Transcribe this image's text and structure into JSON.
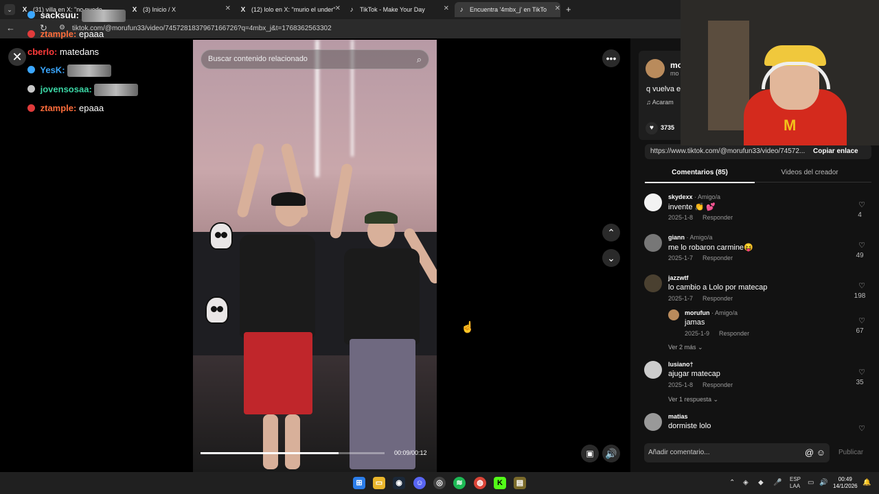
{
  "browser": {
    "tabs": [
      {
        "title": "(31) villa en X: \"no puedo",
        "icon": "x-logo-icon"
      },
      {
        "title": "(3) Inicio / X",
        "icon": "x-logo-icon"
      },
      {
        "title": "(12) lolo en X: \"murio el under\"",
        "icon": "x-logo-icon"
      },
      {
        "title": "TikTok - Make Your Day",
        "icon": "tiktok-logo-icon"
      },
      {
        "title": "Encuentra '4mbx_j' en TikTo",
        "icon": "tiktok-logo-icon"
      }
    ],
    "url": "tiktok.com/@morufun33/video/7457281837967166726?q=4mbx_j&t=1768362563302"
  },
  "chat": [
    {
      "user": "sacksuu",
      "message": "",
      "color": "#ffffff",
      "emote": true
    },
    {
      "user": "ztample",
      "message": "epaaa",
      "color": "#ff6d3b",
      "emote": false
    },
    {
      "user": "cberlo",
      "message": "matedans",
      "color": "#ff3b3b",
      "emote": false
    },
    {
      "user": "YesK",
      "message": "",
      "color": "#3ba7ff",
      "emote": true
    },
    {
      "user": "jovensosaa",
      "message": "",
      "color": "#3bd6a5",
      "emote": true
    },
    {
      "user": "ztample",
      "message": "epaaa",
      "color": "#ff6d3b",
      "emote": false
    }
  ],
  "video": {
    "search_placeholder": "Buscar contenido relacionado",
    "time": "00:09/00:12",
    "progress": 0.75
  },
  "panel": {
    "author_name": "mo",
    "author_sub": "mo",
    "description": "q vuelva e",
    "music": "Acaram",
    "likes": "3735",
    "link": "https://www.tiktok.com/@morufun33/video/74572...",
    "copy_label": "Copiar enlace",
    "tab_comments": "Comentarios (85)",
    "tab_videos": "Videos del creador",
    "comments": [
      {
        "user": "skydexx",
        "tag": "· Amigo/a",
        "text": "invente 👏 💕",
        "date": "2025-1-8",
        "reply": "Responder",
        "likes": "4",
        "avatar": "#f2f2f2"
      },
      {
        "user": "giann",
        "tag": "· Amigo/a",
        "text": "me lo robaron carmine😝",
        "date": "2025-1-7",
        "reply": "Responder",
        "likes": "49",
        "avatar": "#777777"
      },
      {
        "user": "jazzwtf",
        "tag": "",
        "text": "lo cambio a Lolo por matecap",
        "date": "2025-1-7",
        "reply": "Responder",
        "likes": "198",
        "avatar": "#4a4030"
      },
      {
        "user": "morufun",
        "tag": "· Amigo/a",
        "text": "jamas",
        "date": "2025-1-9",
        "reply": "Responder",
        "likes": "67",
        "avatar": "#b98b5c"
      },
      {
        "user": "lusiano†",
        "tag": "",
        "text": "ajugar matecap",
        "date": "2025-1-8",
        "reply": "Responder",
        "likes": "35",
        "avatar": "#cccccc"
      },
      {
        "user": "matias",
        "tag": "",
        "text": "dormiste lolo",
        "date": "",
        "reply": "",
        "likes": "",
        "avatar": "#999999"
      }
    ],
    "view_more_2": "Ver 2 más ⌄",
    "view_more_1": "Ver 1 respuesta ⌄",
    "comment_placeholder": "Añadir comentario...",
    "publish": "Publicar"
  },
  "taskbar": {
    "lang": "ESP",
    "layout": "LAA",
    "time": "00:49",
    "date": "14/1/2026"
  }
}
